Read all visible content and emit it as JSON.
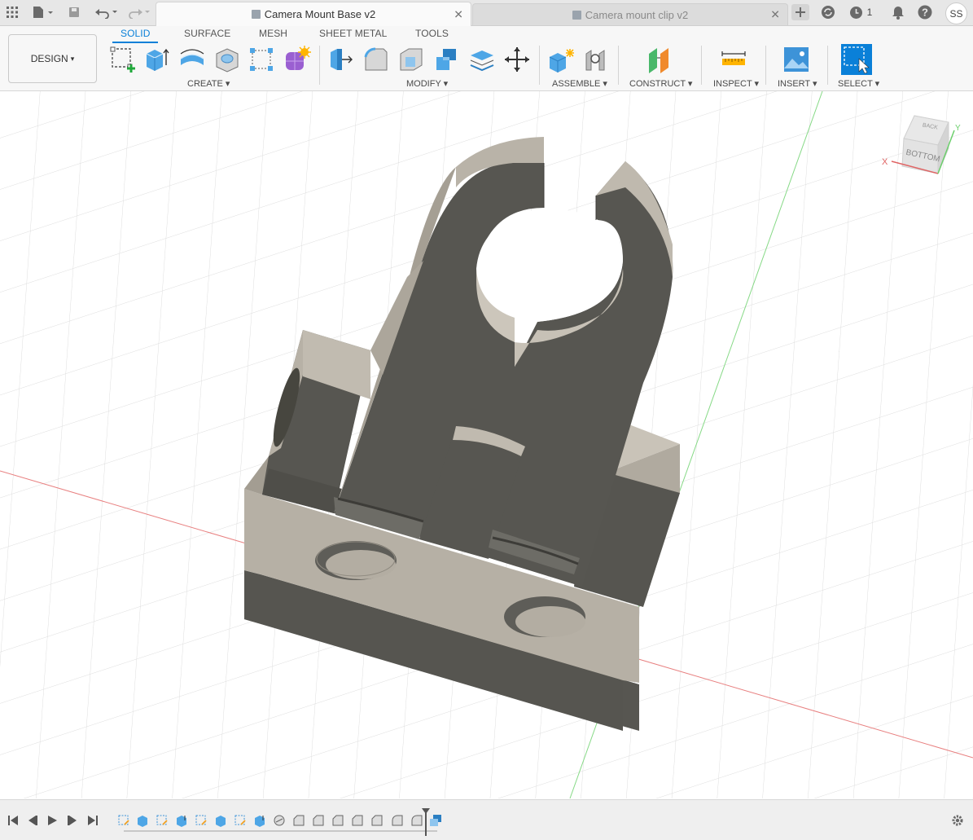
{
  "tabs": [
    {
      "label": "Camera Mount Base v2",
      "active": true
    },
    {
      "label": "Camera mount clip v2",
      "active": false
    }
  ],
  "top_right": {
    "jobs_count": "1",
    "user_initials": "SS"
  },
  "workspace_button": {
    "label": "DESIGN",
    "caret": "▾"
  },
  "workspace_tabs": [
    "SOLID",
    "SURFACE",
    "MESH",
    "SHEET METAL",
    "TOOLS"
  ],
  "groups": {
    "create": "CREATE",
    "modify": "MODIFY",
    "assemble": "ASSEMBLE",
    "construct": "CONSTRUCT",
    "inspect": "INSPECT",
    "insert": "INSERT",
    "select": "SELECT"
  },
  "viewcube": {
    "face_top": "BACK",
    "face_front": "BOTTOM",
    "axis_x": "X",
    "axis_y": "Y"
  },
  "colors": {
    "accent": "#0a80d8",
    "body_dark": "#5a5a55",
    "body_light": "#b7b1a6",
    "grid": "#d8d8d8",
    "axis_red": "#e06464",
    "axis_green": "#6ccf6c"
  },
  "icons": {
    "grid_menu": "apps-grid-icon",
    "file": "file-icon",
    "save": "save-icon",
    "undo": "undo-icon",
    "redo": "redo-icon",
    "new_tab": "plus-icon",
    "extension": "extensions-icon",
    "job_status": "clock-icon",
    "notifications": "bell-icon",
    "help": "help-icon",
    "settings": "gear-icon"
  }
}
